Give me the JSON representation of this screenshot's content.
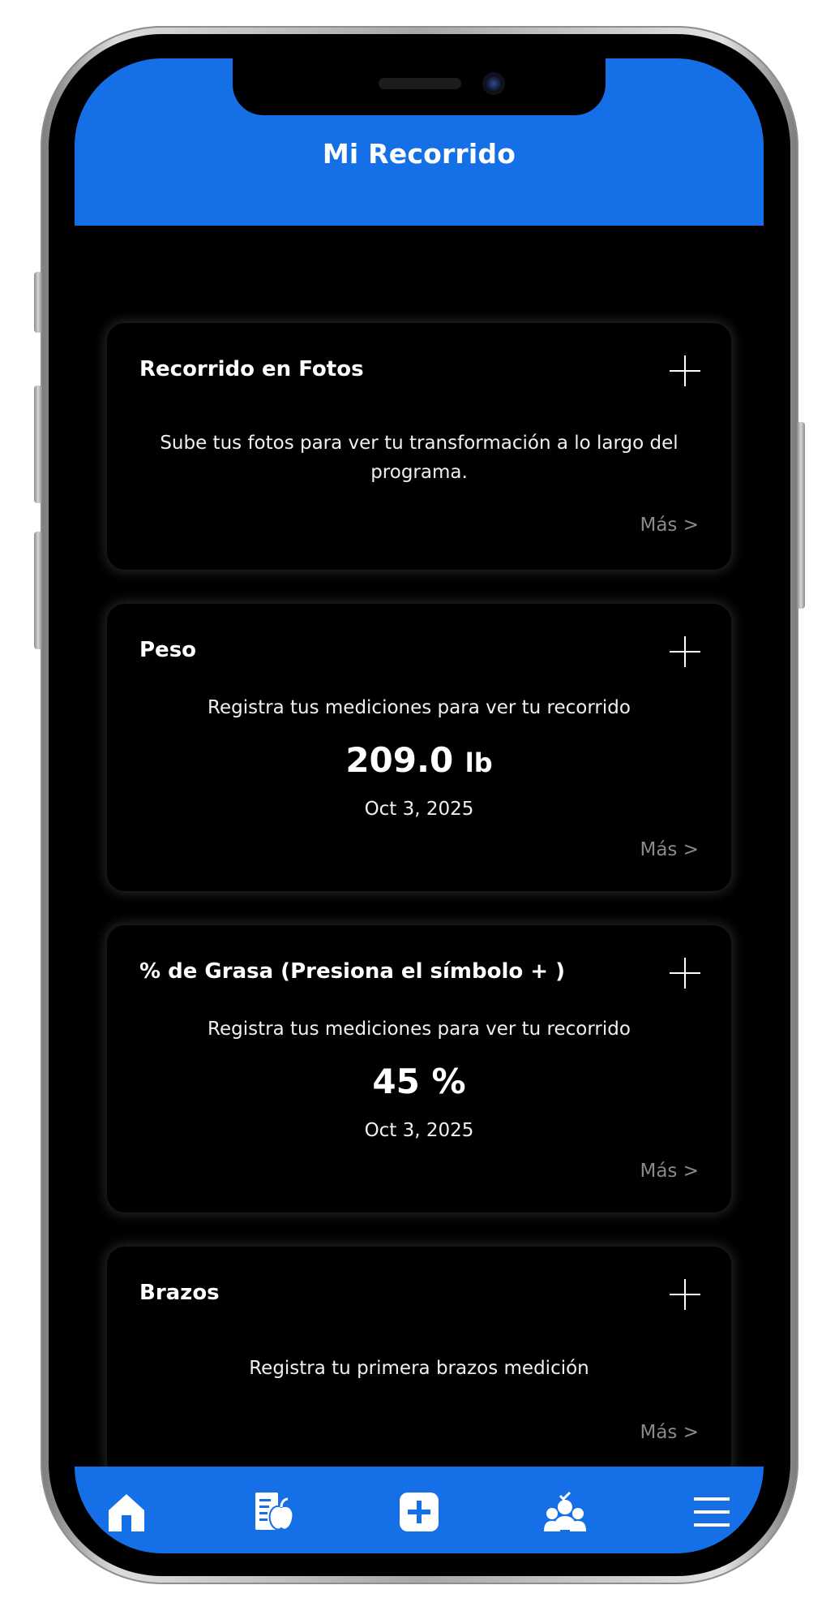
{
  "header": {
    "title": "Mi Recorrido"
  },
  "cards": {
    "fotos": {
      "title": "Recorrido en Fotos",
      "description": "Sube tus fotos para ver tu transformación a lo largo del programa.",
      "more": "Más >"
    },
    "peso": {
      "title": "Peso",
      "description": "Registra tus mediciones para ver tu recorrido",
      "value": "209.0",
      "unit": "lb",
      "date": "Oct 3, 2025",
      "more": "Más >"
    },
    "grasa": {
      "title": "% de Grasa (Presiona el símbolo + )",
      "description": "Registra tus mediciones para ver tu recorrido",
      "value": "45 %",
      "date": "Oct 3, 2025",
      "more": "Más >"
    },
    "brazos": {
      "title": "Brazos",
      "description": "Registra tu primera brazos medición",
      "more": "Más >"
    }
  },
  "bottom_nav": {
    "items": [
      "home-icon",
      "nutrition-plan-icon",
      "add-icon",
      "coach-icon",
      "menu-icon"
    ]
  },
  "colors": {
    "brand_blue": "#1570e8",
    "background": "#000000",
    "text": "#ffffff",
    "muted": "#8a8a8a"
  }
}
